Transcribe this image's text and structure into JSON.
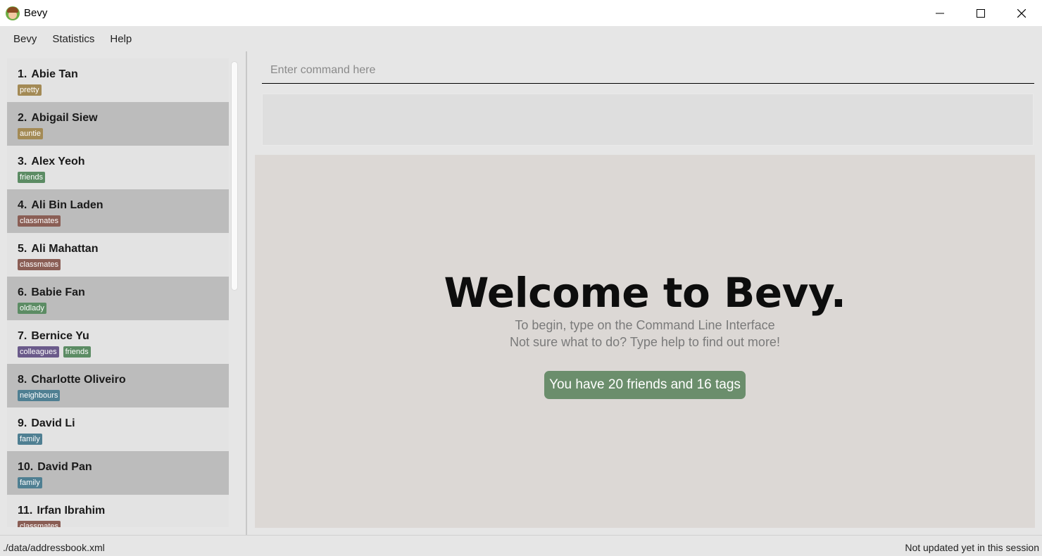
{
  "window": {
    "title": "Bevy"
  },
  "menu": [
    "Bevy",
    "Statistics",
    "Help"
  ],
  "persons": [
    {
      "index": "1.",
      "name": "Abie Tan",
      "tags": [
        {
          "label": "pretty",
          "color": "#a38a55"
        }
      ]
    },
    {
      "index": "2.",
      "name": "Abigail Siew",
      "tags": [
        {
          "label": "auntie",
          "color": "#a38a55"
        }
      ]
    },
    {
      "index": "3.",
      "name": "Alex Yeoh",
      "tags": [
        {
          "label": "friends",
          "color": "#5c8c64"
        }
      ]
    },
    {
      "index": "4.",
      "name": "Ali Bin Laden",
      "tags": [
        {
          "label": "classmates",
          "color": "#8a5e55"
        }
      ]
    },
    {
      "index": "5.",
      "name": "Ali Mahattan",
      "tags": [
        {
          "label": "classmates",
          "color": "#8a5e55"
        }
      ]
    },
    {
      "index": "6.",
      "name": "Babie Fan",
      "tags": [
        {
          "label": "oldlady",
          "color": "#5c8c64"
        }
      ]
    },
    {
      "index": "7.",
      "name": "Bernice Yu",
      "tags": [
        {
          "label": "colleagues",
          "color": "#6a5a8a"
        },
        {
          "label": "friends",
          "color": "#5c8c64"
        }
      ]
    },
    {
      "index": "8.",
      "name": "Charlotte Oliveiro",
      "tags": [
        {
          "label": "neighbours",
          "color": "#4f7f92"
        }
      ]
    },
    {
      "index": "9.",
      "name": "David Li",
      "tags": [
        {
          "label": "family",
          "color": "#4f7f92"
        }
      ]
    },
    {
      "index": "10.",
      "name": "David Pan",
      "tags": [
        {
          "label": "family",
          "color": "#4f7f92"
        }
      ]
    },
    {
      "index": "11.",
      "name": "Irfan Ibrahim",
      "tags": [
        {
          "label": "classmates",
          "color": "#8a5e55"
        }
      ]
    }
  ],
  "command": {
    "placeholder": "Enter command here",
    "value": ""
  },
  "result": {
    "text": ""
  },
  "welcome": {
    "title": "Welcome to Bevy.",
    "line1": "To begin, type on the Command Line Interface",
    "line2": "Not sure what to do? Type help to find out more!",
    "stats": "You have 20 friends and 16 tags"
  },
  "status": {
    "file_path": "./data/addressbook.xml",
    "sync": "Not updated yet in this session"
  }
}
